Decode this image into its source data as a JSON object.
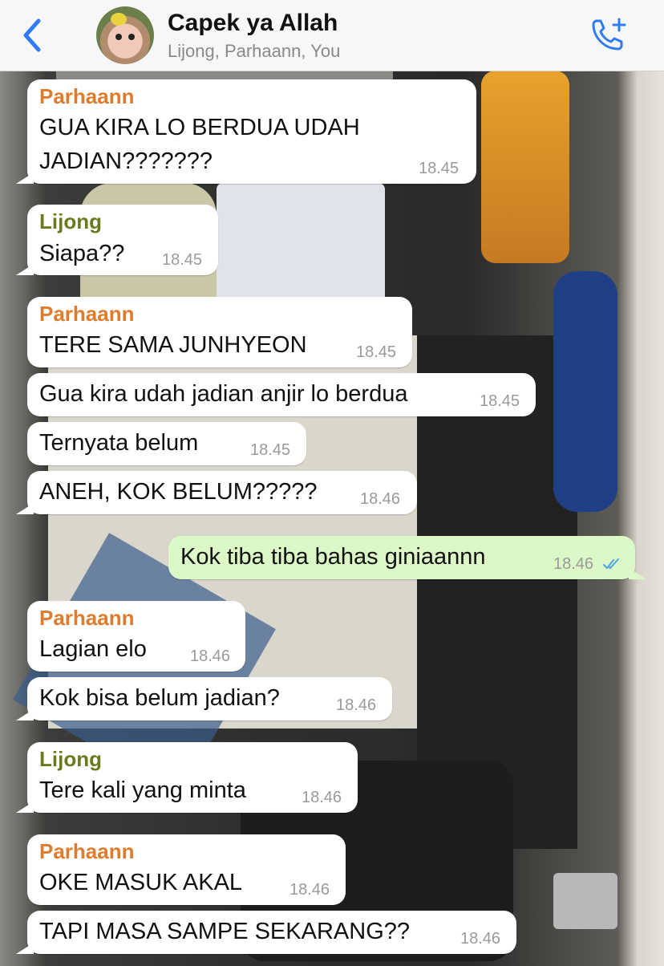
{
  "header": {
    "title": "Capek ya Allah",
    "subtitle": "Lijong, Parhaann, You",
    "back_icon": "chevron-left-icon",
    "call_icon": "add-call-icon",
    "accent_color": "#2f7bf6"
  },
  "messages": [
    {
      "sender": "Parhaann",
      "lines": [
        "GUA KIRA LO BERDUA UDAH",
        "JADIAN???????"
      ],
      "time": "18.45",
      "direction": "incoming"
    },
    {
      "sender": "Lijong",
      "lines": [
        "Siapa??"
      ],
      "time": "18.45",
      "direction": "incoming"
    },
    {
      "sender": "Parhaann",
      "lines": [
        "TERE SAMA JUNHYEON"
      ],
      "time": "18.45",
      "direction": "incoming"
    },
    {
      "sender": "",
      "lines": [
        "Gua kira udah jadian anjir lo berdua"
      ],
      "time": "18.45",
      "direction": "incoming"
    },
    {
      "sender": "",
      "lines": [
        "Ternyata belum"
      ],
      "time": "18.45",
      "direction": "incoming"
    },
    {
      "sender": "",
      "lines": [
        "ANEH, KOK BELUM?????"
      ],
      "time": "18.46",
      "direction": "incoming"
    },
    {
      "sender": "",
      "lines": [
        "Kok tiba tiba bahas giniaannn"
      ],
      "time": "18.46",
      "direction": "outgoing",
      "status": "read"
    },
    {
      "sender": "Parhaann",
      "lines": [
        "Lagian elo"
      ],
      "time": "18.46",
      "direction": "incoming"
    },
    {
      "sender": "",
      "lines": [
        "Kok bisa belum jadian?"
      ],
      "time": "18.46",
      "direction": "incoming"
    },
    {
      "sender": "Lijong",
      "lines": [
        "Tere kali yang minta"
      ],
      "time": "18.46",
      "direction": "incoming"
    },
    {
      "sender": "Parhaann",
      "lines": [
        "OKE MASUK AKAL"
      ],
      "time": "18.46",
      "direction": "incoming"
    },
    {
      "sender": "",
      "lines": [
        "TAPI MASA SAMPE SEKARANG??"
      ],
      "time": "18.46",
      "direction": "incoming"
    }
  ],
  "colors": {
    "incoming_bubble": "#ffffff",
    "outgoing_bubble": "#dcf8c6",
    "parhaann_name": "#e07b2c",
    "lijong_name": "#6b7a1e",
    "read_checks": "#4fa3e0"
  }
}
